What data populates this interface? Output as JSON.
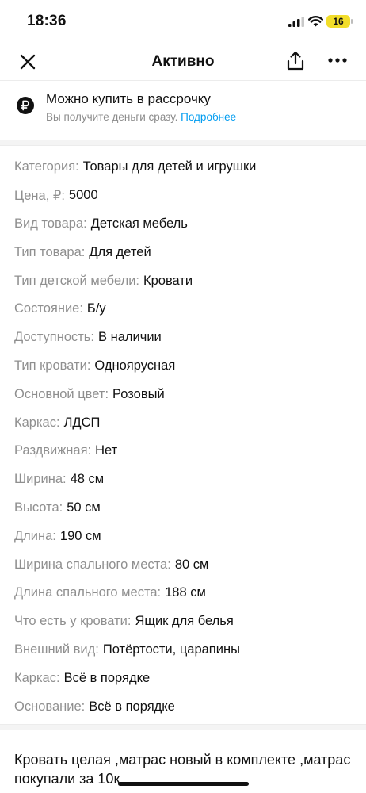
{
  "status_bar": {
    "time": "18:36",
    "battery_level": "16",
    "battery_color": "#f2dd2a"
  },
  "nav": {
    "title": "Активно",
    "close_icon": "close-icon",
    "share_icon": "share-icon",
    "more_icon": "more-icon"
  },
  "installment": {
    "icon": "ruble-icon",
    "title": "Можно купить в рассрочку",
    "subtitle": "Вы получите деньги сразу.",
    "link": "Подробнее",
    "link_color": "#009cf0"
  },
  "params": [
    {
      "key": "Категория:",
      "value": "Товары для детей и игрушки"
    },
    {
      "key": "Цена, ₽:",
      "value": "5000"
    },
    {
      "key": "Вид товара:",
      "value": "Детская мебель"
    },
    {
      "key": "Тип товара:",
      "value": "Для детей"
    },
    {
      "key": "Тип детской мебели:",
      "value": "Кровати"
    },
    {
      "key": "Состояние:",
      "value": "Б/у"
    },
    {
      "key": "Доступность:",
      "value": "В наличии"
    },
    {
      "key": "Тип кровати:",
      "value": "Одноярусная"
    },
    {
      "key": "Основной цвет:",
      "value": "Розовый"
    },
    {
      "key": "Каркас:",
      "value": "ЛДСП"
    },
    {
      "key": "Раздвижная:",
      "value": "Нет"
    },
    {
      "key": "Ширина:",
      "value": "48 см"
    },
    {
      "key": "Высота:",
      "value": "50 см"
    },
    {
      "key": "Длина:",
      "value": "190 см"
    },
    {
      "key": "Ширина спального места:",
      "value": "80 см"
    },
    {
      "key": "Длина спального места:",
      "value": "188 см"
    },
    {
      "key": "Что есть у кровати:",
      "value": "Ящик для белья"
    },
    {
      "key": "Внешний вид:",
      "value": "Потёртости, царапины"
    },
    {
      "key": "Каркас:",
      "value": "Всё в порядке"
    },
    {
      "key": "Основание:",
      "value": "Всё в порядке"
    }
  ],
  "description": "Кровать целая ,матрас новый в комплекте ,матрас покупали за 10к"
}
